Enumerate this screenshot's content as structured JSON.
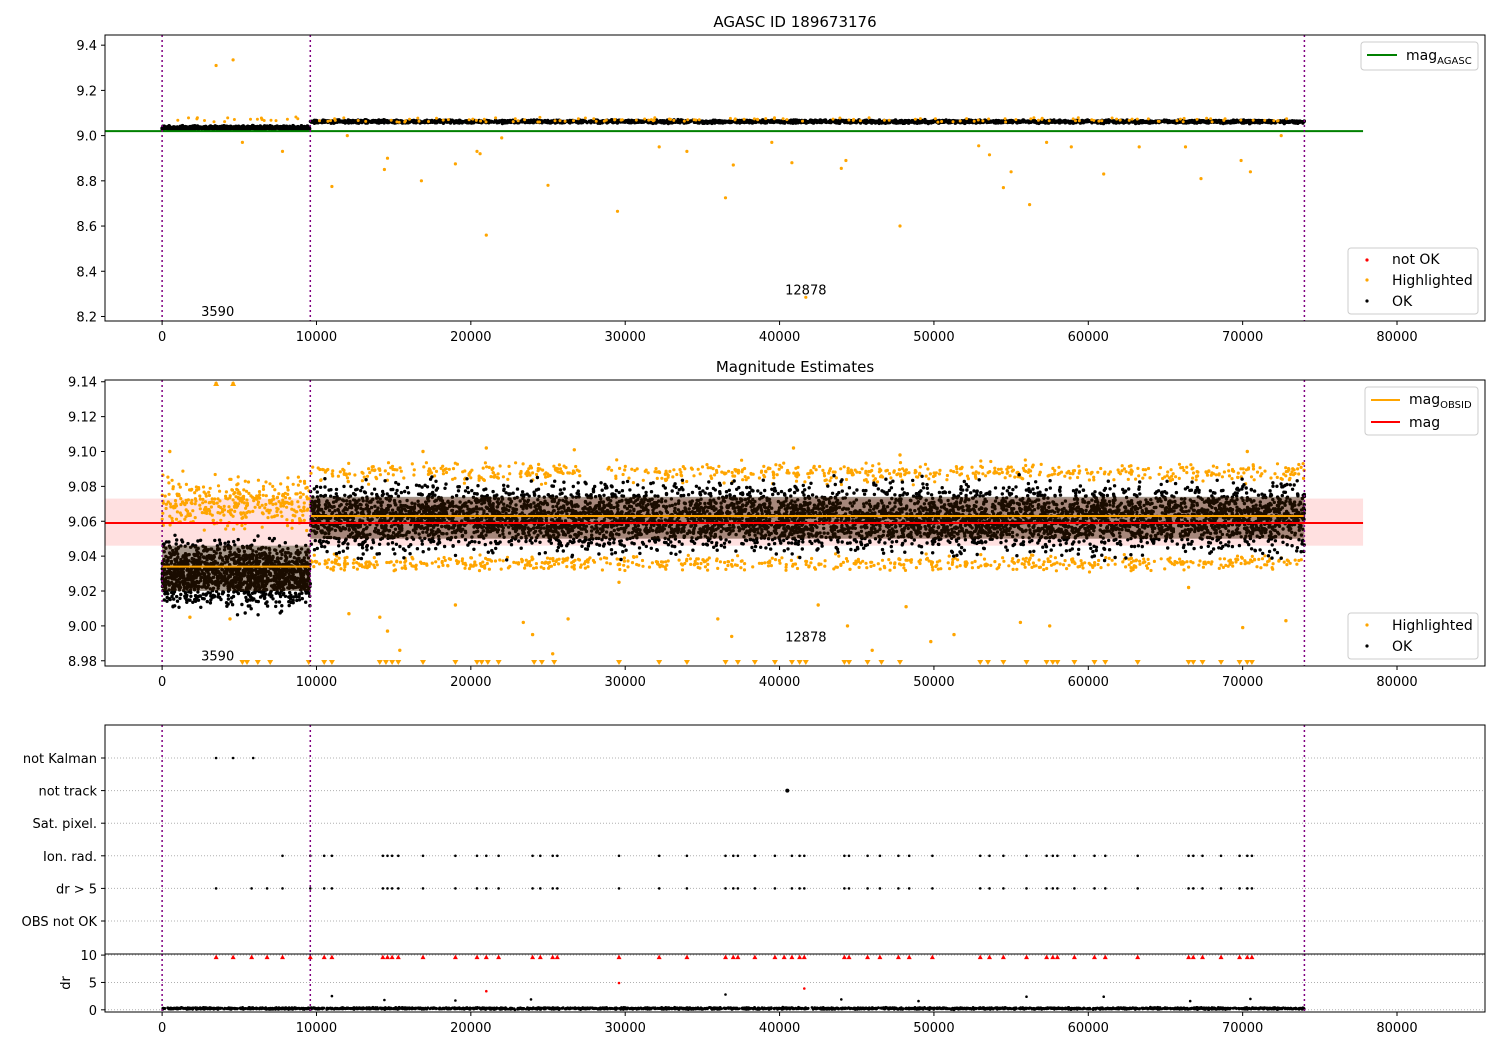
{
  "chart_data": [
    {
      "type": "scatter",
      "title": "AGASC ID 189673176",
      "xlabel": "",
      "ylabel": "",
      "xlim": [
        -3700,
        85700
      ],
      "ylim": [
        8.18,
        9.445
      ],
      "x_ticks": [
        0,
        10000,
        20000,
        30000,
        40000,
        50000,
        60000,
        70000,
        80000
      ],
      "x_tick_labels": [
        "0",
        "10000",
        "20000",
        "30000",
        "40000",
        "50000",
        "60000",
        "70000",
        "80000"
      ],
      "y_ticks": [
        8.2,
        8.4,
        8.6,
        8.8,
        9.0,
        9.2,
        9.4
      ],
      "y_tick_labels": [
        "8.2",
        "8.4",
        "8.6",
        "8.8",
        "9.0",
        "9.2",
        "9.4"
      ],
      "vlines": [
        0,
        9600,
        74000
      ],
      "annotations": [
        {
          "text": "3590",
          "x": 3600,
          "y": 8.225
        },
        {
          "text": "12878",
          "x": 41700,
          "y": 8.32
        }
      ],
      "line_legend": [
        {
          "label": "mag",
          "subscript": "AGASC",
          "color": "#008000"
        }
      ],
      "point_legend": [
        {
          "label": "not OK",
          "color": "#ff0000"
        },
        {
          "label": "Highlighted",
          "color": "#ffa500"
        },
        {
          "label": "OK",
          "color": "#000000"
        }
      ],
      "hlines": [
        {
          "name": "mag_AGASC",
          "y": 9.02,
          "x_range": [
            -3700,
            77800
          ],
          "color": "#008000"
        }
      ],
      "series": [
        {
          "name": "OK",
          "color": "#000000",
          "segments": [
            {
              "x_range": [
                0,
                9600
              ],
              "y_center": 9.034,
              "y_spread": 0.012
            },
            {
              "x_range": [
                9600,
                74000
              ],
              "y_center": 9.062,
              "y_spread": 0.01
            }
          ]
        },
        {
          "name": "Highlighted",
          "color": "#ffa500",
          "points": [
            [
              3500,
              9.31
            ],
            [
              4600,
              9.335
            ],
            [
              21000,
              8.56
            ],
            [
              29500,
              8.665
            ],
            [
              36500,
              8.725
            ],
            [
              41700,
              8.285
            ],
            [
              47800,
              8.6
            ],
            [
              56200,
              8.695
            ],
            [
              11000,
              8.775
            ],
            [
              16800,
              8.8
            ],
            [
              25000,
              8.78
            ],
            [
              54500,
              8.77
            ],
            [
              67300,
              8.81
            ],
            [
              70500,
              8.84
            ],
            [
              14400,
              8.85
            ],
            [
              44000,
              8.855
            ],
            [
              14600,
              8.9
            ],
            [
              20400,
              8.93
            ],
            [
              34000,
              8.93
            ],
            [
              40800,
              8.88
            ],
            [
              53600,
              8.915
            ],
            [
              61000,
              8.83
            ],
            [
              7800,
              8.93
            ],
            [
              20600,
              8.92
            ],
            [
              39500,
              8.97
            ],
            [
              57300,
              8.97
            ],
            [
              66300,
              8.95
            ],
            [
              69900,
              8.89
            ],
            [
              5200,
              8.97
            ],
            [
              32200,
              8.95
            ],
            [
              52900,
              8.955
            ],
            [
              58900,
              8.95
            ],
            [
              63300,
              8.95
            ],
            [
              19000,
              8.875
            ],
            [
              37000,
              8.87
            ],
            [
              44300,
              8.89
            ],
            [
              55000,
              8.84
            ],
            [
              72500,
              9.0
            ],
            [
              12000,
              9.0
            ],
            [
              22000,
              8.99
            ]
          ]
        }
      ]
    },
    {
      "type": "scatter",
      "title": "Magnitude Estimates",
      "xlabel": "",
      "ylabel": "",
      "xlim": [
        -3700,
        85700
      ],
      "ylim": [
        8.977,
        9.141
      ],
      "x_ticks": [
        0,
        10000,
        20000,
        30000,
        40000,
        50000,
        60000,
        70000,
        80000
      ],
      "x_tick_labels": [
        "0",
        "10000",
        "20000",
        "30000",
        "40000",
        "50000",
        "60000",
        "70000",
        "80000"
      ],
      "y_ticks": [
        8.98,
        9.0,
        9.02,
        9.04,
        9.06,
        9.08,
        9.1,
        9.12,
        9.14
      ],
      "y_tick_labels": [
        "8.98",
        "9.00",
        "9.02",
        "9.04",
        "9.06",
        "9.08",
        "9.10",
        "9.12",
        "9.14"
      ],
      "vlines": [
        0,
        9600,
        74000
      ],
      "annotations": [
        {
          "text": "3590",
          "x": 3600,
          "y": 8.983
        },
        {
          "text": "12878",
          "x": 41700,
          "y": 8.994
        }
      ],
      "line_legend": [
        {
          "label": "mag",
          "subscript": "OBSID",
          "color": "#ffa500"
        },
        {
          "label": "mag",
          "subscript": "",
          "color": "#ff0000"
        }
      ],
      "point_legend": [
        {
          "label": "Highlighted",
          "color": "#ffa500"
        },
        {
          "label": "OK",
          "color": "#000000"
        }
      ],
      "band": {
        "y_range": [
          9.046,
          9.073
        ],
        "x_range": [
          -3700,
          77800
        ],
        "color": "#ffcccc"
      },
      "hlines": [
        {
          "name": "mag",
          "y": 9.059,
          "x_range": [
            -3700,
            77800
          ],
          "color": "#ff0000"
        },
        {
          "name": "mag_OBSID_1",
          "y": 9.034,
          "x_range": [
            0,
            9600
          ],
          "color": "#ffa500"
        },
        {
          "name": "mag_OBSID_2",
          "y": 9.063,
          "x_range": [
            9600,
            74000
          ],
          "color": "#ffa500"
        }
      ],
      "obsid_bands": [
        {
          "x_range": [
            0,
            9600
          ],
          "y_range": [
            9.02,
            9.046
          ]
        },
        {
          "x_range": [
            9600,
            74000
          ],
          "y_range": [
            9.05,
            9.074
          ]
        }
      ],
      "series": [
        {
          "name": "OK",
          "color": "#000000",
          "segments": [
            {
              "x_range": [
                0,
                9600
              ],
              "y_center": 9.03,
              "y_spread": 0.025
            },
            {
              "x_range": [
                9600,
                74000
              ],
              "y_center": 9.062,
              "y_spread": 0.026
            }
          ]
        },
        {
          "name": "Highlighted",
          "color": "#ffa500",
          "segments": [
            {
              "x_range": [
                0,
                9600
              ],
              "y_center": 9.07,
              "y_spread": 0.02
            },
            {
              "x_range": [
                9600,
                74000
              ],
              "y_center": 9.088,
              "y_spread": 0.008
            },
            {
              "x_range": [
                9600,
                74000
              ],
              "y_center": 9.036,
              "y_spread": 0.006
            }
          ],
          "points": [
            [
              3500,
              9.139
            ],
            [
              4600,
              9.139
            ],
            [
              500,
              9.1
            ],
            [
              16900,
              9.1
            ],
            [
              21000,
              9.102
            ],
            [
              40900,
              9.102
            ],
            [
              26700,
              9.101
            ],
            [
              70300,
              9.1
            ],
            [
              47800,
              9.098
            ],
            [
              12100,
              9.007
            ],
            [
              14100,
              9.005
            ],
            [
              14600,
              8.997
            ],
            [
              19000,
              9.012
            ],
            [
              23400,
              9.002
            ],
            [
              24000,
              8.995
            ],
            [
              26300,
              9.004
            ],
            [
              29600,
              9.025
            ],
            [
              36000,
              9.004
            ],
            [
              36900,
              8.994
            ],
            [
              42500,
              9.012
            ],
            [
              44400,
              9.0
            ],
            [
              48200,
              9.011
            ],
            [
              49800,
              8.991
            ],
            [
              51300,
              8.995
            ],
            [
              55600,
              9.002
            ],
            [
              57500,
              9.0
            ],
            [
              66500,
              9.022
            ],
            [
              70000,
              8.999
            ],
            [
              72800,
              9.003
            ],
            [
              1800,
              9.005
            ],
            [
              4400,
              9.004
            ],
            [
              46000,
              8.986
            ],
            [
              25300,
              8.984
            ],
            [
              15400,
              8.986
            ]
          ]
        }
      ],
      "below_range_markers_x": [
        5200,
        5500,
        6200,
        7000,
        9500,
        10500,
        11000,
        14100,
        14500,
        14900,
        15300,
        16900,
        19000,
        20400,
        20700,
        21100,
        21800,
        24100,
        24600,
        25400,
        29600,
        32200,
        34000,
        36500,
        37300,
        38400,
        39700,
        40800,
        41300,
        41700,
        44200,
        44500,
        45700,
        46600,
        47800,
        53000,
        53500,
        54500,
        56000,
        57300,
        57700,
        58000,
        59100,
        60400,
        61100,
        63200,
        66500,
        66800,
        67400,
        68600,
        69800,
        70300,
        70600
      ]
    },
    {
      "type": "scatter",
      "title": "",
      "xlabel": "",
      "ylabel": "",
      "xlim": [
        -3700,
        85700
      ],
      "categories": [
        "not Kalman",
        "not track",
        "Sat. pixel.",
        "Ion. rad.",
        "dr > 5",
        "OBS not OK"
      ],
      "vlines": [
        0,
        9600,
        74000
      ],
      "flag_points": {
        "not Kalman": [
          3500,
          4600,
          5900
        ],
        "not track": [
          40500
        ],
        "Sat. pixel.": [],
        "Ion. rad.": [
          7800,
          9600,
          10500,
          11000,
          14300,
          14600,
          14900,
          15300,
          16900,
          19000,
          20400,
          21000,
          21800,
          24000,
          24500,
          25300,
          25600,
          29600,
          32200,
          34000,
          36500,
          37000,
          37300,
          38400,
          39700,
          40800,
          41300,
          41600,
          44200,
          44500,
          45700,
          46500,
          47700,
          48400,
          49900,
          53000,
          53600,
          54500,
          56000,
          57300,
          57700,
          58000,
          59100,
          60400,
          61100,
          63200,
          66500,
          66800,
          67400,
          68600,
          69800,
          70300,
          70600
        ],
        "dr > 5": [
          3500,
          5800,
          6800,
          7800,
          9600,
          10500,
          11000,
          14300,
          14600,
          14900,
          15300,
          16900,
          19000,
          20400,
          21000,
          21800,
          24000,
          24500,
          25300,
          25600,
          29600,
          32200,
          34000,
          36500,
          37000,
          37300,
          38400,
          39700,
          40800,
          41300,
          41600,
          44200,
          44500,
          45700,
          46500,
          47700,
          48400,
          49900,
          53000,
          53600,
          54500,
          56000,
          57300,
          57700,
          58000,
          59100,
          60400,
          61100,
          63200,
          66500,
          66800,
          67400,
          68600,
          69800,
          70300,
          70600
        ],
        "OBS not OK": []
      }
    },
    {
      "type": "scatter",
      "title": "",
      "xlabel": "",
      "ylabel": "dr",
      "xlim": [
        -3700,
        85700
      ],
      "ylim": [
        -0.4,
        10.2
      ],
      "x_ticks": [
        0,
        10000,
        20000,
        30000,
        40000,
        50000,
        60000,
        70000,
        80000
      ],
      "x_tick_labels": [
        "0",
        "10000",
        "20000",
        "30000",
        "40000",
        "50000",
        "60000",
        "70000",
        "80000"
      ],
      "y_ticks": [
        0,
        5,
        10
      ],
      "y_tick_labels": [
        "0",
        "5",
        "10"
      ],
      "vlines": [
        0,
        9600,
        74000
      ],
      "series": [
        {
          "name": "OK",
          "color": "#000000",
          "segment": {
            "x_range": [
              0,
              74000
            ],
            "y_center": 0.25,
            "y_spread": 0.25
          },
          "points": [
            [
              11000,
              2.5
            ],
            [
              14400,
              1.8
            ],
            [
              19000,
              1.7
            ],
            [
              23900,
              1.9
            ],
            [
              36500,
              2.8
            ],
            [
              44000,
              1.9
            ],
            [
              49000,
              1.6
            ],
            [
              56000,
              2.4
            ],
            [
              61000,
              2.4
            ],
            [
              66600,
              1.6
            ],
            [
              70500,
              2.0
            ]
          ]
        },
        {
          "name": "not OK",
          "color": "#ff0000",
          "points": [
            [
              21000,
              3.4
            ],
            [
              29600,
              4.9
            ],
            [
              41600,
              3.9
            ]
          ],
          "clipped_x": [
            3500,
            4600,
            5800,
            6800,
            7800,
            9600,
            10500,
            11000,
            14300,
            14600,
            14900,
            15300,
            16900,
            19000,
            20400,
            21000,
            21800,
            24000,
            24500,
            25300,
            25600,
            29600,
            32200,
            34000,
            36500,
            37000,
            37300,
            38400,
            39700,
            40300,
            40800,
            41300,
            41600,
            44200,
            44500,
            45700,
            46500,
            47700,
            48400,
            49900,
            53000,
            53600,
            54500,
            56000,
            57300,
            57700,
            58000,
            59100,
            60400,
            61100,
            63200,
            66500,
            66800,
            67400,
            68600,
            69800,
            70300,
            70600
          ]
        }
      ]
    }
  ]
}
